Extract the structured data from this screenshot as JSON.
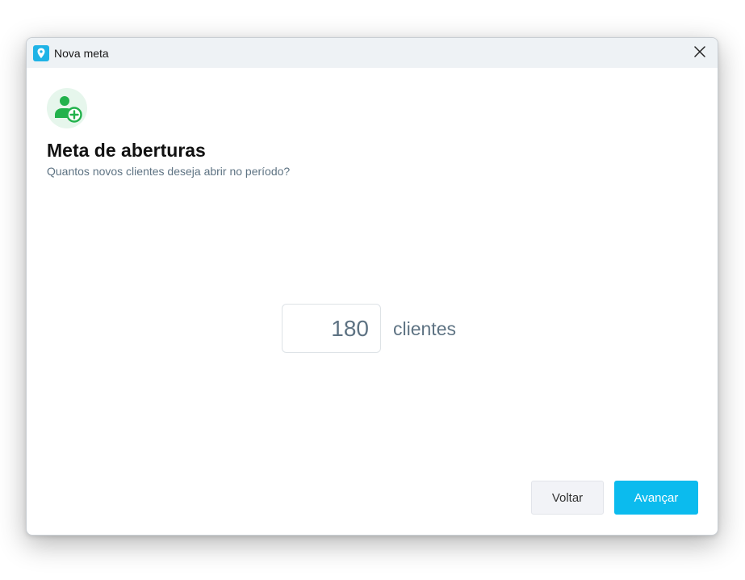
{
  "window": {
    "title": "Nova meta",
    "app_icon": "location-pin-icon",
    "close_icon": "close-icon"
  },
  "header": {
    "icon": "add-user-icon",
    "title": "Meta de aberturas",
    "subtitle": "Quantos novos clientes deseja abrir no período?"
  },
  "goal": {
    "value": "180",
    "unit": "clientes"
  },
  "buttons": {
    "back_label": "Voltar",
    "next_label": "Avançar"
  },
  "colors": {
    "accent": "#0bbbee",
    "icon_green": "#22b24c",
    "icon_bg": "#e6f6ec",
    "muted_text": "#5e7383"
  }
}
